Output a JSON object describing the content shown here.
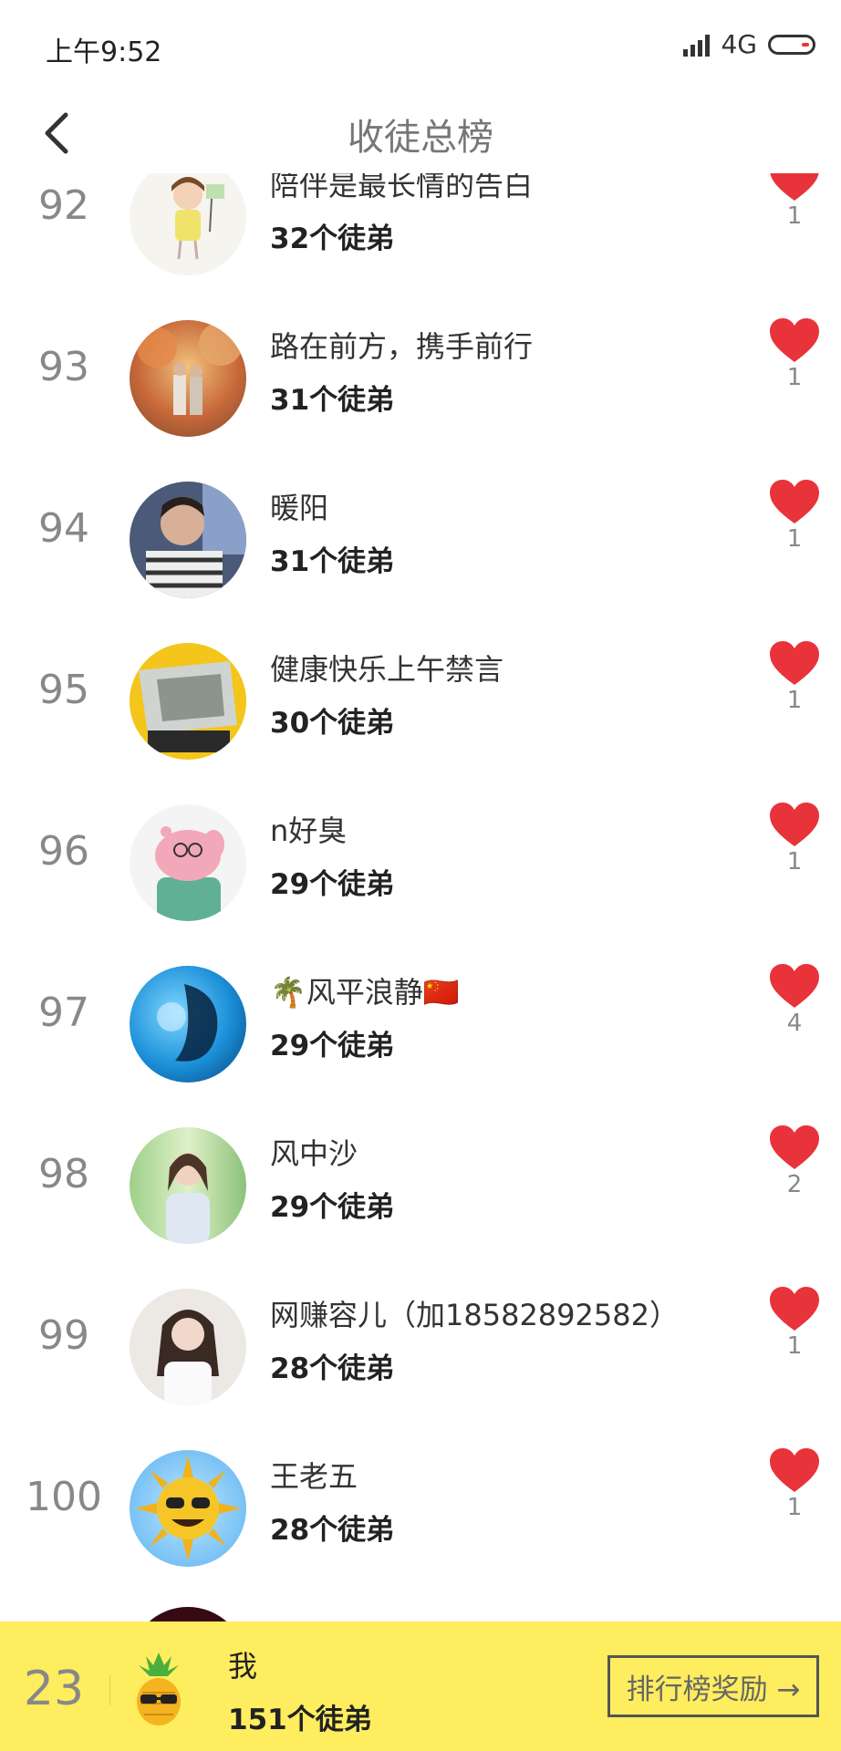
{
  "status_bar": {
    "time": "上午9:52",
    "network": "4G"
  },
  "header": {
    "title": "收徒总榜"
  },
  "list": {
    "items": [
      {
        "rank": "92",
        "name": "陪伴是最长情的告白",
        "count": "32个徒弟",
        "likes": "1",
        "avatar_icon": "girl-cartoon-avatar"
      },
      {
        "rank": "93",
        "name": "路在前方，携手前行",
        "count": "31个徒弟",
        "likes": "1",
        "avatar_icon": "autumn-couple-avatar"
      },
      {
        "rank": "94",
        "name": "暖阳",
        "count": "31个徒弟",
        "likes": "1",
        "avatar_icon": "man-photo-avatar"
      },
      {
        "rank": "95",
        "name": "健康快乐上午禁言",
        "count": "30个徒弟",
        "likes": "1",
        "avatar_icon": "yellow-photo-avatar"
      },
      {
        "rank": "96",
        "name": "n好臭",
        "count": "29个徒弟",
        "likes": "1",
        "avatar_icon": "pig-cartoon-avatar"
      },
      {
        "rank": "97",
        "name": "🌴风平浪静🇨🇳",
        "count": "29个徒弟",
        "likes": "4",
        "avatar_icon": "blue-abstract-avatar"
      },
      {
        "rank": "98",
        "name": "风中沙",
        "count": "29个徒弟",
        "likes": "2",
        "avatar_icon": "woman-photo-avatar"
      },
      {
        "rank": "99",
        "name": "网赚容儿（加18582892582）",
        "count": "28个徒弟",
        "likes": "1",
        "avatar_icon": "woman-white-photo-avatar"
      },
      {
        "rank": "100",
        "name": "王老五",
        "count": "28个徒弟",
        "likes": "1",
        "avatar_icon": "sun-sunglasses-avatar"
      }
    ]
  },
  "footer": {
    "rank": "23",
    "name": "我",
    "count": "151个徒弟",
    "reward_label": "排行榜奖励 →",
    "avatar_icon": "pineapple-sunglasses-avatar"
  },
  "colors": {
    "accent": "#fded5f",
    "heart": "#e8333b"
  }
}
